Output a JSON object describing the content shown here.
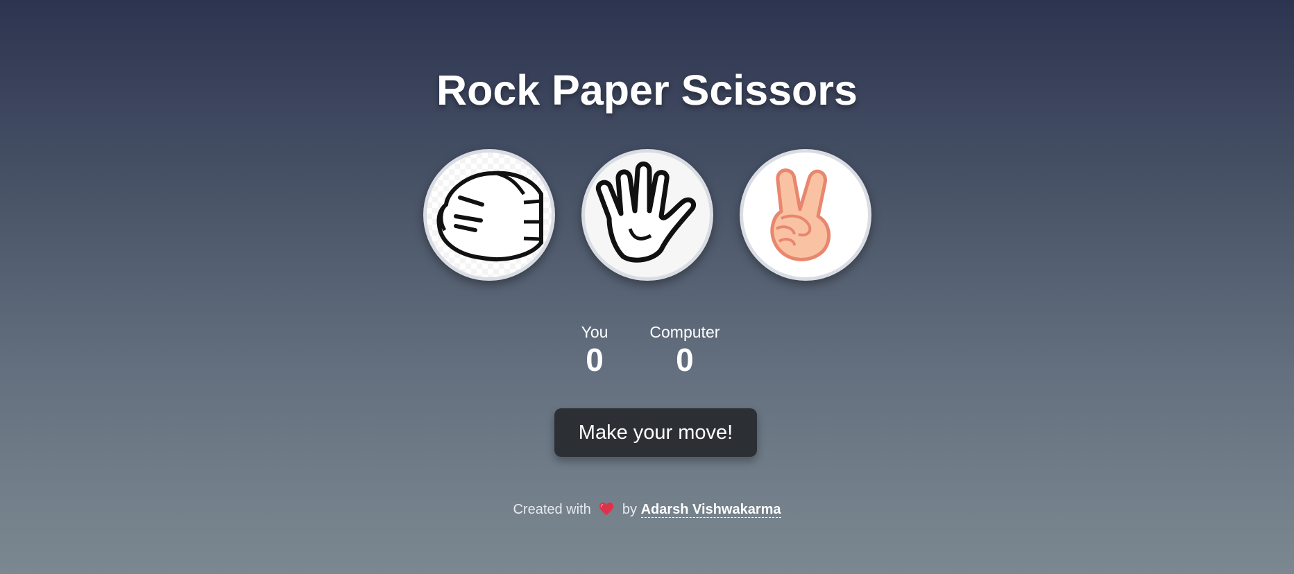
{
  "game": {
    "title": "Rock Paper Scissors",
    "choices": [
      {
        "name": "rock",
        "icon": "fist-hand-icon"
      },
      {
        "name": "paper",
        "icon": "open-hand-icon"
      },
      {
        "name": "scissors",
        "icon": "peace-hand-icon"
      }
    ]
  },
  "score": {
    "player_label": "You",
    "player_value": "0",
    "computer_label": "Computer",
    "computer_value": "0"
  },
  "action": {
    "move_label": "Make your move!"
  },
  "footer": {
    "prefix": "Created with",
    "heart_icon": "heart-icon",
    "by": "by",
    "author": "Adarsh Vishwakarma"
  },
  "colors": {
    "background_top": "#2d3450",
    "background_bottom": "#7c8890",
    "button": "#2c3035",
    "heart": "#e0314b"
  }
}
